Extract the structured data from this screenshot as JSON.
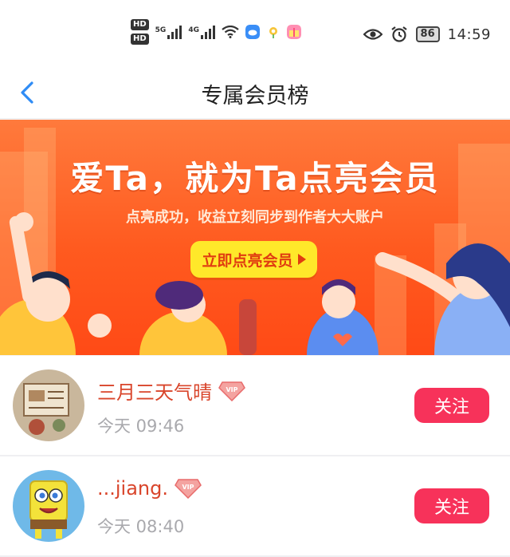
{
  "status_bar": {
    "hd1": "HD",
    "hd2": "HD",
    "net1": "5G",
    "net2": "4G",
    "battery": "86",
    "time": "14:59"
  },
  "header": {
    "back_icon": "chevron-left-icon",
    "title": "专属会员榜"
  },
  "banner": {
    "title": "爱Ta，就为Ta点亮会员",
    "subtitle": "点亮成功，收益立刻同步到作者大大账户",
    "cta": "立即点亮会员"
  },
  "members": [
    {
      "name": "三月三天气晴",
      "badge": "VIP",
      "time": "今天 09:46",
      "follow": "关注"
    },
    {
      "name": "...jiang.",
      "badge": "VIP",
      "time": "今天 08:40",
      "follow": "关注"
    }
  ],
  "colors": {
    "accent": "#f7325a",
    "name": "#d9452b",
    "banner": "#ff5a1f",
    "back": "#2f8cf5"
  }
}
